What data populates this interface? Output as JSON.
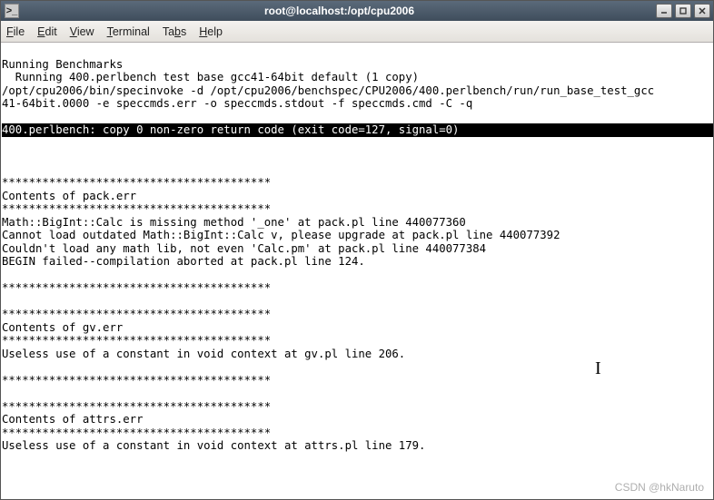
{
  "titlebar": {
    "icon": "terminal-icon",
    "title": "root@localhost:/opt/cpu2006",
    "buttons": {
      "minimize": "_",
      "maximize": "❐",
      "close": "✕"
    }
  },
  "menubar": {
    "file": "File",
    "edit": "Edit",
    "view": "View",
    "terminal": "Terminal",
    "tabs": "Tabs",
    "help": "Help"
  },
  "terminal": {
    "lines": [
      "Running Benchmarks",
      "  Running 400.perlbench test base gcc41-64bit default (1 copy)",
      "/opt/cpu2006/bin/specinvoke -d /opt/cpu2006/benchspec/CPU2006/400.perlbench/run/run_base_test_gcc",
      "41-64bit.0000 -e speccmds.err -o speccmds.stdout -f speccmds.cmd -C -q",
      "",
      "",
      "",
      "",
      "****************************************",
      "Contents of pack.err",
      "****************************************",
      "Math::BigInt::Calc is missing method '_one' at pack.pl line 440077360",
      "Cannot load outdated Math::BigInt::Calc v, please upgrade at pack.pl line 440077392",
      "Couldn't load any math lib, not even 'Calc.pm' at pack.pl line 440077384",
      "BEGIN failed--compilation aborted at pack.pl line 124.",
      "",
      "****************************************",
      "",
      "****************************************",
      "Contents of gv.err",
      "****************************************",
      "Useless use of a constant in void context at gv.pl line 206.",
      "",
      "****************************************",
      "",
      "****************************************",
      "Contents of attrs.err",
      "****************************************",
      "Useless use of a constant in void context at attrs.pl line 179.",
      ""
    ],
    "error_line": "400.perlbench: copy 0 non-zero return code (exit code=127, signal=0)"
  },
  "watermark": "CSDN @hkNaruto"
}
